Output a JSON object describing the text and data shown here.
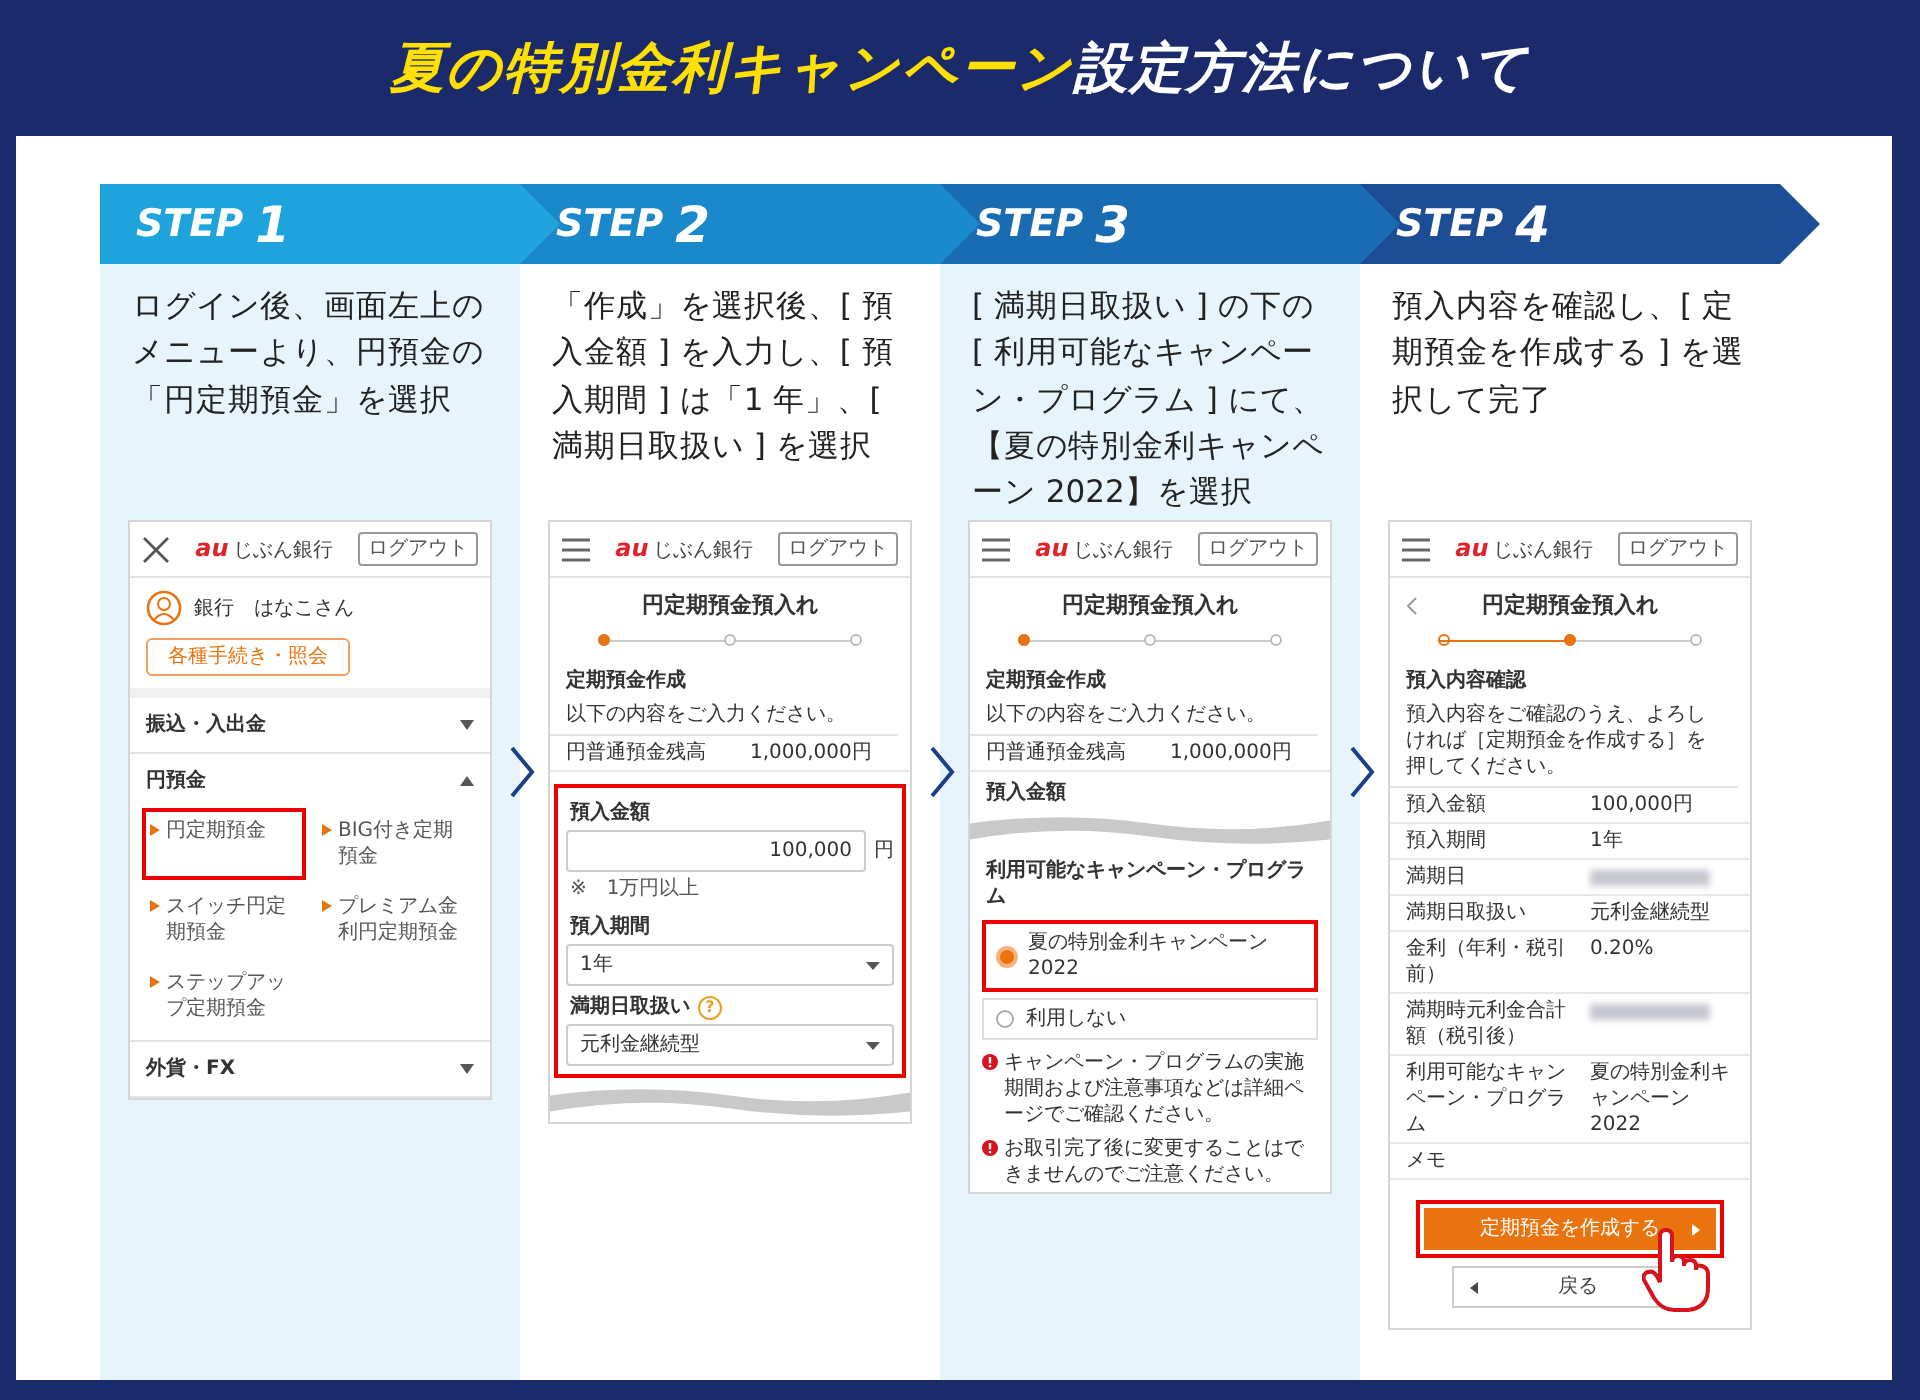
{
  "title": {
    "highlight": "夏の特別金利キャンペーン",
    "rest": "設定方法について"
  },
  "steps": [
    {
      "label": "STEP",
      "number": "1",
      "description": "ログイン後、画面左上のメニューより、円預金の「円定期預金」を選択",
      "screen": {
        "header": {
          "logo_mark": "au",
          "logo_text": "じぶん銀行",
          "logout": "ログアウト"
        },
        "blocks": [
          {
            "kind": "user",
            "name": "銀行　はなこさん"
          },
          {
            "kind": "outline-button",
            "label": "各種手続き・照会"
          },
          {
            "kind": "menu",
            "label": "振込・入出金",
            "expanded": false
          },
          {
            "kind": "menu",
            "label": "円預金",
            "expanded": true,
            "children": [
              {
                "label": "円定期預金",
                "highlighted": true
              },
              {
                "label": "BIG付き定期預金",
                "highlighted": false
              },
              {
                "label": "スイッチ円定期預金",
                "highlighted": false
              },
              {
                "label": "プレミアム金利円定期預金",
                "highlighted": false
              },
              {
                "label": "ステップアップ定期預金",
                "highlighted": false
              }
            ]
          },
          {
            "kind": "menu",
            "label": "外貨・FX",
            "expanded": false
          }
        ]
      }
    },
    {
      "label": "STEP",
      "number": "2",
      "description": "「作成」を選択後、[ 預入金額 ] を入力し、[ 預入期間 ] は「1 年」、[ 満期日取扱い ] を選択",
      "screen": {
        "header": {
          "logo_mark": "au",
          "logo_text": "じぶん銀行",
          "logout": "ログアウト"
        },
        "blocks": [
          {
            "kind": "title",
            "text": "円定期預金預入れ",
            "back": false
          },
          {
            "kind": "progress",
            "level": 0
          },
          {
            "kind": "heading",
            "text": "定期預金作成"
          },
          {
            "kind": "text",
            "text": "以下の内容をご入力ください。"
          },
          {
            "kind": "row",
            "label": "円普通預金残高",
            "value": "1,000,000円",
            "blurred": false
          },
          {
            "kind": "group",
            "highlighted": true,
            "children": [
              {
                "kind": "heading",
                "text": "預入金額"
              },
              {
                "kind": "amount",
                "value": "100,000",
                "unit": "円"
              },
              {
                "kind": "note",
                "mark": "※",
                "text": "1万円以上"
              },
              {
                "kind": "heading",
                "text": "預入期間"
              },
              {
                "kind": "select",
                "value": "1年"
              },
              {
                "kind": "heading",
                "text": "満期日取扱い",
                "help": "?"
              },
              {
                "kind": "select",
                "value": "元利金継続型"
              }
            ]
          },
          {
            "kind": "wave"
          }
        ]
      }
    },
    {
      "label": "STEP",
      "number": "3",
      "description": "[ 満期日取扱い ] の下の [ 利用可能なキャンペーン・プログラム ] にて、【夏の特別金利キャンペーン 2022】を選択",
      "screen": {
        "header": {
          "logo_mark": "au",
          "logo_text": "じぶん銀行",
          "logout": "ログアウト"
        },
        "blocks": [
          {
            "kind": "title",
            "text": "円定期預金預入れ",
            "back": false
          },
          {
            "kind": "progress",
            "level": 0
          },
          {
            "kind": "heading",
            "text": "定期預金作成"
          },
          {
            "kind": "text",
            "text": "以下の内容をご入力ください。"
          },
          {
            "kind": "row",
            "label": "円普通預金残高",
            "value": "1,000,000円",
            "blurred": false
          },
          {
            "kind": "heading",
            "text": "預入金額"
          },
          {
            "kind": "wave"
          },
          {
            "kind": "heading",
            "text": "利用可能なキャンペーン・プログラム"
          },
          {
            "kind": "radio",
            "label": "夏の特別金利キャンペーン2022",
            "selected": true,
            "highlighted": true
          },
          {
            "kind": "radio",
            "label": "利用しない",
            "selected": false,
            "highlighted": false
          },
          {
            "kind": "warning",
            "text": "キャンペーン・プログラムの実施期間および注意事項などは詳細ページでご確認ください。"
          },
          {
            "kind": "warning",
            "text": "お取引完了後に変更することはできませんのでご注意ください。"
          }
        ]
      }
    },
    {
      "label": "STEP",
      "number": "4",
      "description": "預入内容を確認し、[ 定期預金を作成する ] を選択して完了",
      "screen": {
        "header": {
          "logo_mark": "au",
          "logo_text": "じぶん銀行",
          "logout": "ログアウト"
        },
        "blocks": [
          {
            "kind": "title",
            "text": "円定期預金預入れ",
            "back": true
          },
          {
            "kind": "progress",
            "level": 0.5
          },
          {
            "kind": "heading",
            "text": "預入内容確認"
          },
          {
            "kind": "text",
            "text": "預入内容をご確認のうえ、よろしければ［定期預金を作成する］を押してください。"
          },
          {
            "kind": "row",
            "label": "預入金額",
            "value": "100,000円",
            "blurred": false
          },
          {
            "kind": "row",
            "label": "預入期間",
            "value": "1年",
            "blurred": false
          },
          {
            "kind": "row",
            "label": "満期日",
            "blurred": true
          },
          {
            "kind": "row",
            "label": "満期日取扱い",
            "value": "元利金継続型",
            "blurred": false
          },
          {
            "kind": "row",
            "label": "金利（年利・税引前）",
            "value": "0.20%",
            "blurred": false
          },
          {
            "kind": "row",
            "label": "満期時元利金合計額（税引後）",
            "blurred": true
          },
          {
            "kind": "row",
            "label": "利用可能なキャンペーン・プログラム",
            "value": "夏の特別金利キャンペーン2022",
            "blurred": false
          },
          {
            "kind": "row",
            "label": "メモ",
            "blurred": false
          },
          {
            "kind": "primary-button",
            "label": "定期預金を作成する",
            "highlighted": true,
            "pointer": true
          },
          {
            "kind": "secondary-button",
            "label": "戻る"
          }
        ]
      }
    }
  ]
}
